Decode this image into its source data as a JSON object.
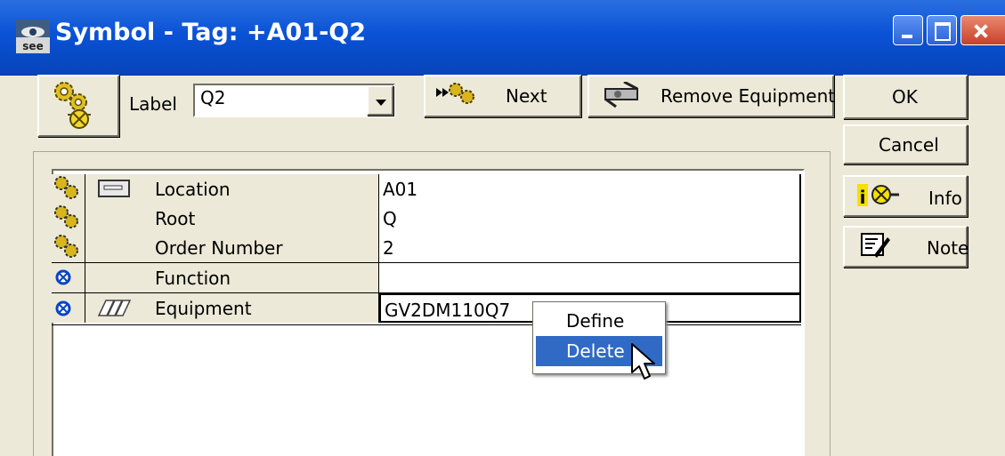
{
  "window": {
    "title": "Symbol - Tag: +A01-Q2"
  },
  "toolbar": {
    "label_text": "Label",
    "label_value": "Q2",
    "next_label": "Next",
    "remove_label": "Remove Equipment"
  },
  "actions": {
    "ok_label": "OK",
    "cancel_label": "Cancel",
    "info_label": "Info",
    "note_label": "Note"
  },
  "grid": {
    "rows": [
      {
        "name": "Location",
        "value": "A01",
        "icon": "gear-cluster-icon",
        "extra_icon": "keyboard-icon"
      },
      {
        "name": "Root",
        "value": "Q",
        "icon": "gear-cluster-icon"
      },
      {
        "name": "Order Number",
        "value": "2",
        "icon": "gear-cluster-icon"
      },
      {
        "name": "Function",
        "value": "",
        "icon": "blue-circle-icon"
      },
      {
        "name": "Equipment",
        "value": "GV2DM110Q7",
        "icon": "blue-circle-icon",
        "extra_icon": "catalog-book-icon"
      }
    ]
  },
  "context_menu": {
    "items": [
      {
        "label": "Define",
        "selected": false
      },
      {
        "label": "Delete",
        "selected": true
      }
    ]
  },
  "colors": {
    "titlebar": "#0a52d6",
    "face": "#ece9d8",
    "selection": "#316ac5"
  }
}
